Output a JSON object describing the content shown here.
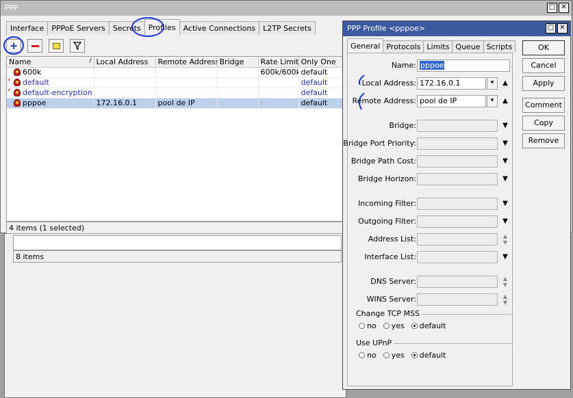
{
  "main_window": {
    "title": "PPP",
    "tabs": [
      "Interface",
      "PPPoE Servers",
      "Secrets",
      "Profiles",
      "Active Connections",
      "L2TP Secrets"
    ],
    "active_tab": "Profiles",
    "toolbar": {
      "add_icon": "plus-icon",
      "remove_icon": "minus-icon",
      "comment_icon": "note-icon",
      "filter_icon": "filter-icon"
    },
    "table": {
      "columns": [
        "Name",
        "Local Address",
        "Remote Address",
        "Bridge",
        "Rate Limit...",
        "Only One"
      ],
      "rows": [
        {
          "marker": "",
          "name": "600k",
          "local": "",
          "remote": "",
          "bridge": "",
          "rate": "600k/600k",
          "only_one": "default"
        },
        {
          "marker": "*",
          "name": "default",
          "local": "",
          "remote": "",
          "bridge": "",
          "rate": "",
          "only_one": "default"
        },
        {
          "marker": "*",
          "name": "default-encryption",
          "local": "",
          "remote": "",
          "bridge": "",
          "rate": "",
          "only_one": "default"
        },
        {
          "marker": "",
          "name": "pppoe",
          "local": "172.16.0.1",
          "remote": "pool de IP",
          "bridge": "",
          "rate": "",
          "only_one": "default"
        }
      ]
    },
    "status": "4 items (1 selected)"
  },
  "background_window": {
    "status": "8 items"
  },
  "profile_dialog": {
    "title": "PPP Profile <pppoe>",
    "tabs": [
      "General",
      "Protocols",
      "Limits",
      "Queue",
      "Scripts"
    ],
    "active_tab": "General",
    "fields": {
      "name": {
        "label": "Name:",
        "value": "pppoe"
      },
      "local_address": {
        "label": "Local Address:",
        "value": "172.16.0.1"
      },
      "remote_address": {
        "label": "Remote Address:",
        "value": "pool de IP"
      },
      "bridge": {
        "label": "Bridge:",
        "value": ""
      },
      "bridge_port_priority": {
        "label": "Bridge Port Priority:",
        "value": ""
      },
      "bridge_path_cost": {
        "label": "Bridge Path Cost:",
        "value": ""
      },
      "bridge_horizon": {
        "label": "Bridge Horizon:",
        "value": ""
      },
      "incoming_filter": {
        "label": "Incoming Filter:",
        "value": ""
      },
      "outgoing_filter": {
        "label": "Outgoing Filter:",
        "value": ""
      },
      "address_list": {
        "label": "Address List:",
        "value": ""
      },
      "interface_list": {
        "label": "Interface List:",
        "value": ""
      },
      "dns_server": {
        "label": "DNS Server:",
        "value": ""
      },
      "wins_server": {
        "label": "WINS Server:",
        "value": ""
      }
    },
    "change_tcp_mss": {
      "label": "Change TCP MSS",
      "options": [
        "no",
        "yes",
        "default"
      ],
      "selected": "default"
    },
    "use_upnp": {
      "label": "Use UPnP",
      "options": [
        "no",
        "yes",
        "default"
      ],
      "selected": "default"
    },
    "buttons": [
      "OK",
      "Cancel",
      "Apply",
      "Comment",
      "Copy",
      "Remove"
    ]
  },
  "annotation_color": "#1c2ed8"
}
